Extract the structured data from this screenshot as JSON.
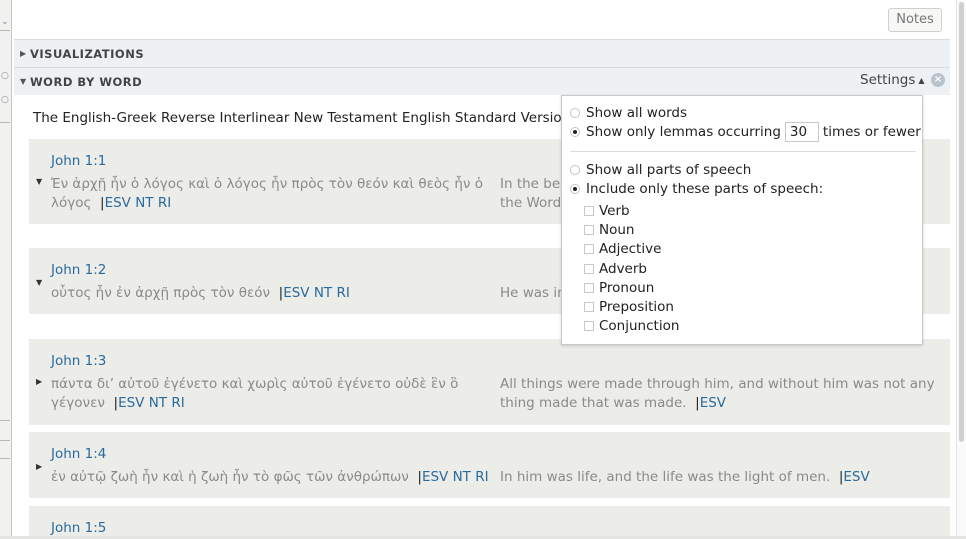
{
  "notes_button": "Notes",
  "sections": {
    "visualizations": "VISUALIZATIONS",
    "word_by_word": "WORD BY WORD"
  },
  "settings_label": "Settings",
  "work_title": "The English-Greek Reverse Interlinear New Testament English Standard Version",
  "verses": [
    {
      "ref": "John 1:1",
      "greek": "Ἐν ἀρχῇ ἦν ὁ λόγος καὶ ὁ λόγος ἦν πρὸς τὸν θεόν καὶ θεὸς ἦν ὁ λόγος",
      "greek_link": "ESV NT RI",
      "english": "In the beg",
      "english_line2": "the Word",
      "english_link": ""
    },
    {
      "ref": "John 1:2",
      "greek": "οὗτος ἦν ἐν ἀρχῇ πρὸς τὸν θεόν",
      "greek_link": "ESV NT RI",
      "english": "He was in",
      "english_link": ""
    },
    {
      "ref": "John 1:3",
      "greek": "πάντα δι’ αὐτοῦ ἐγένετο καὶ χωρὶς αὐτοῦ ἐγένετο οὐδὲ ἓν ὃ γέγονεν",
      "greek_link": "ESV NT RI",
      "english": "All things were made through him, and without him was not any thing made that was made.",
      "english_link": "ESV"
    },
    {
      "ref": "John 1:4",
      "greek": "ἐν αὐτῷ ζωὴ ἦν καὶ ἡ ζωὴ ἦν τὸ φῶς τῶν ἀνθρώπων",
      "greek_link": "ESV NT RI",
      "english": "In him was life, and the life was the light of men.",
      "english_link": "ESV"
    },
    {
      "ref": "John 1:5"
    }
  ],
  "settings_popup": {
    "show_all_words": "Show all words",
    "show_only_lemmas_prefix": "Show only lemmas occurring",
    "lemma_count": "30",
    "show_only_lemmas_suffix": "times or fewer",
    "show_all_parts": "Show all parts of speech",
    "include_only_parts": "Include only these parts of speech:",
    "parts_of_speech": [
      "Verb",
      "Noun",
      "Adjective",
      "Adverb",
      "Pronoun",
      "Preposition",
      "Conjunction"
    ]
  }
}
